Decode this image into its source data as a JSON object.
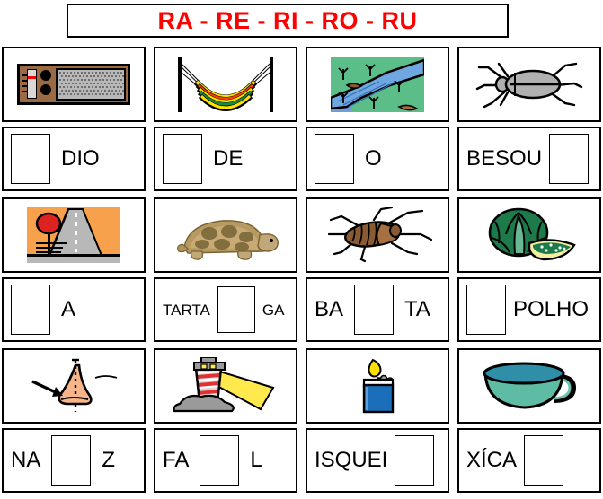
{
  "title": {
    "text": "RA - RE - RI - RO - RU",
    "color": "#ff0000"
  },
  "rows": [
    {
      "pictures": [
        {
          "name": "radio-illustration",
          "alt": "radio"
        },
        {
          "name": "hammock-illustration",
          "alt": "hammock"
        },
        {
          "name": "river-illustration",
          "alt": "river"
        },
        {
          "name": "beetle-illustration",
          "alt": "beetle"
        }
      ],
      "words": [
        {
          "name": "word-radio",
          "before": "",
          "after": "DIO",
          "blank": "before"
        },
        {
          "name": "word-rede",
          "before": "",
          "after": "DE",
          "blank": "before"
        },
        {
          "name": "word-rio",
          "before": "",
          "after": "O",
          "blank": "before"
        },
        {
          "name": "word-besouro",
          "before": "BESOU",
          "after": "",
          "blank": "after"
        }
      ]
    },
    {
      "pictures": [
        {
          "name": "street-illustration",
          "alt": "street"
        },
        {
          "name": "tortoise-illustration",
          "alt": "tortoise"
        },
        {
          "name": "cockroach-illustration",
          "alt": "cockroach"
        },
        {
          "name": "cabbage-illustration",
          "alt": "cabbage"
        }
      ],
      "words": [
        {
          "name": "word-rua",
          "before": "",
          "after": "A",
          "blank": "before"
        },
        {
          "name": "word-tartaruga",
          "before": "TARTA",
          "after": "GA",
          "blank": "middle"
        },
        {
          "name": "word-barata",
          "before": "BA",
          "after": "TA",
          "blank": "middle"
        },
        {
          "name": "word-repolho",
          "before": "",
          "after": "POLHO",
          "blank": "before"
        }
      ]
    },
    {
      "pictures": [
        {
          "name": "nose-illustration",
          "alt": "nose"
        },
        {
          "name": "lighthouse-illustration",
          "alt": "lighthouse"
        },
        {
          "name": "lighter-illustration",
          "alt": "lighter"
        },
        {
          "name": "cup-illustration",
          "alt": "cup"
        }
      ],
      "words": [
        {
          "name": "word-nariz",
          "before": "NA",
          "after": "Z",
          "blank": "middle"
        },
        {
          "name": "word-farol",
          "before": "FA",
          "after": "L",
          "blank": "middle"
        },
        {
          "name": "word-isqueiro",
          "before": "ISQUEI",
          "after": "",
          "blank": "after"
        },
        {
          "name": "word-xicara",
          "before": "XÍCA",
          "after": "",
          "blank": "after"
        }
      ]
    }
  ]
}
